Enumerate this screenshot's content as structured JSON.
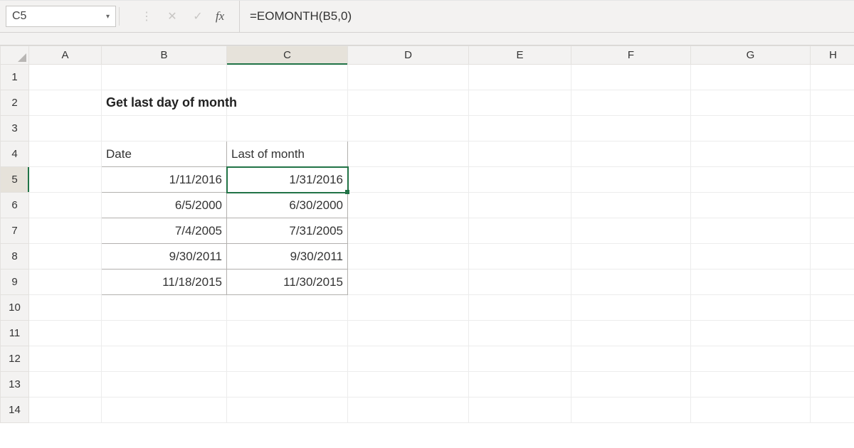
{
  "namebox": {
    "value": "C5"
  },
  "formula": {
    "value": "=EOMONTH(B5,0)"
  },
  "columns": [
    "A",
    "B",
    "C",
    "D",
    "E",
    "F",
    "G",
    "H"
  ],
  "rows": [
    "1",
    "2",
    "3",
    "4",
    "5",
    "6",
    "7",
    "8",
    "9",
    "10",
    "11",
    "12",
    "13",
    "14"
  ],
  "active": {
    "col": "C",
    "row": "5"
  },
  "title": {
    "text": "Get last day of month"
  },
  "table": {
    "headers": {
      "date": "Date",
      "last": "Last of month"
    },
    "rows": [
      {
        "date": "1/11/2016",
        "last": "1/31/2016"
      },
      {
        "date": "6/5/2000",
        "last": "6/30/2000"
      },
      {
        "date": "7/4/2005",
        "last": "7/31/2005"
      },
      {
        "date": "9/30/2011",
        "last": "9/30/2011"
      },
      {
        "date": "11/18/2015",
        "last": "11/30/2015"
      }
    ]
  },
  "icons": {
    "dropdown": "▾",
    "cancel": "✕",
    "enter": "✓",
    "fx": "fx",
    "vdots": "⋮"
  }
}
